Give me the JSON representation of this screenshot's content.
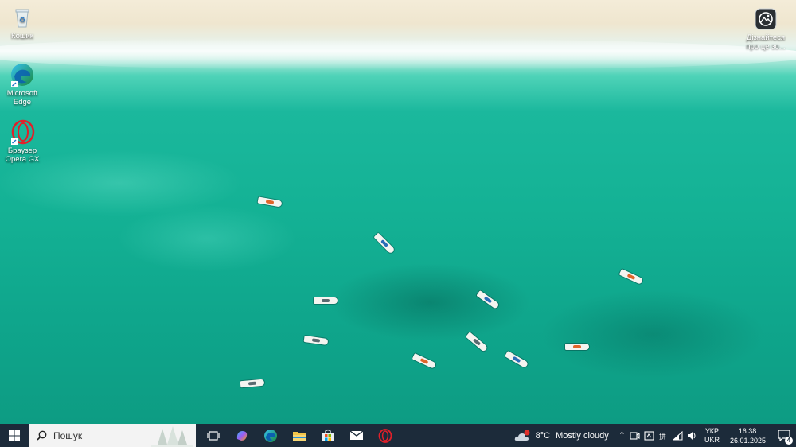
{
  "desktop": {
    "icons": [
      {
        "label": "Кошик",
        "icon": "recycle-bin-icon"
      },
      {
        "label": "Microsoft Edge",
        "icon": "edge-icon"
      },
      {
        "label": "Браузер Opera GX",
        "icon": "opera-gx-icon"
      },
      {
        "label": "Дізнайтеся про це зо...",
        "icon": "spotlight-icon"
      }
    ]
  },
  "taskbar": {
    "start_icon": "windows-start-icon",
    "search_placeholder": "Пошук",
    "apps": [
      "task-view-icon",
      "copilot-icon",
      "edge-icon",
      "file-explorer-icon",
      "microsoft-store-icon",
      "mail-icon",
      "opera-gx-icon"
    ],
    "weather": {
      "temp": "8°C",
      "condition": "Mostly cloudy"
    },
    "language": {
      "line1": "УКР",
      "line2": "UKR"
    },
    "clock": {
      "time": "16:38",
      "date": "26.01.2025"
    },
    "notifications": "4"
  },
  "colors": {
    "taskbar": "#1c2b3a",
    "accent": "#0f9e86",
    "opera_red": "#e0202a"
  }
}
